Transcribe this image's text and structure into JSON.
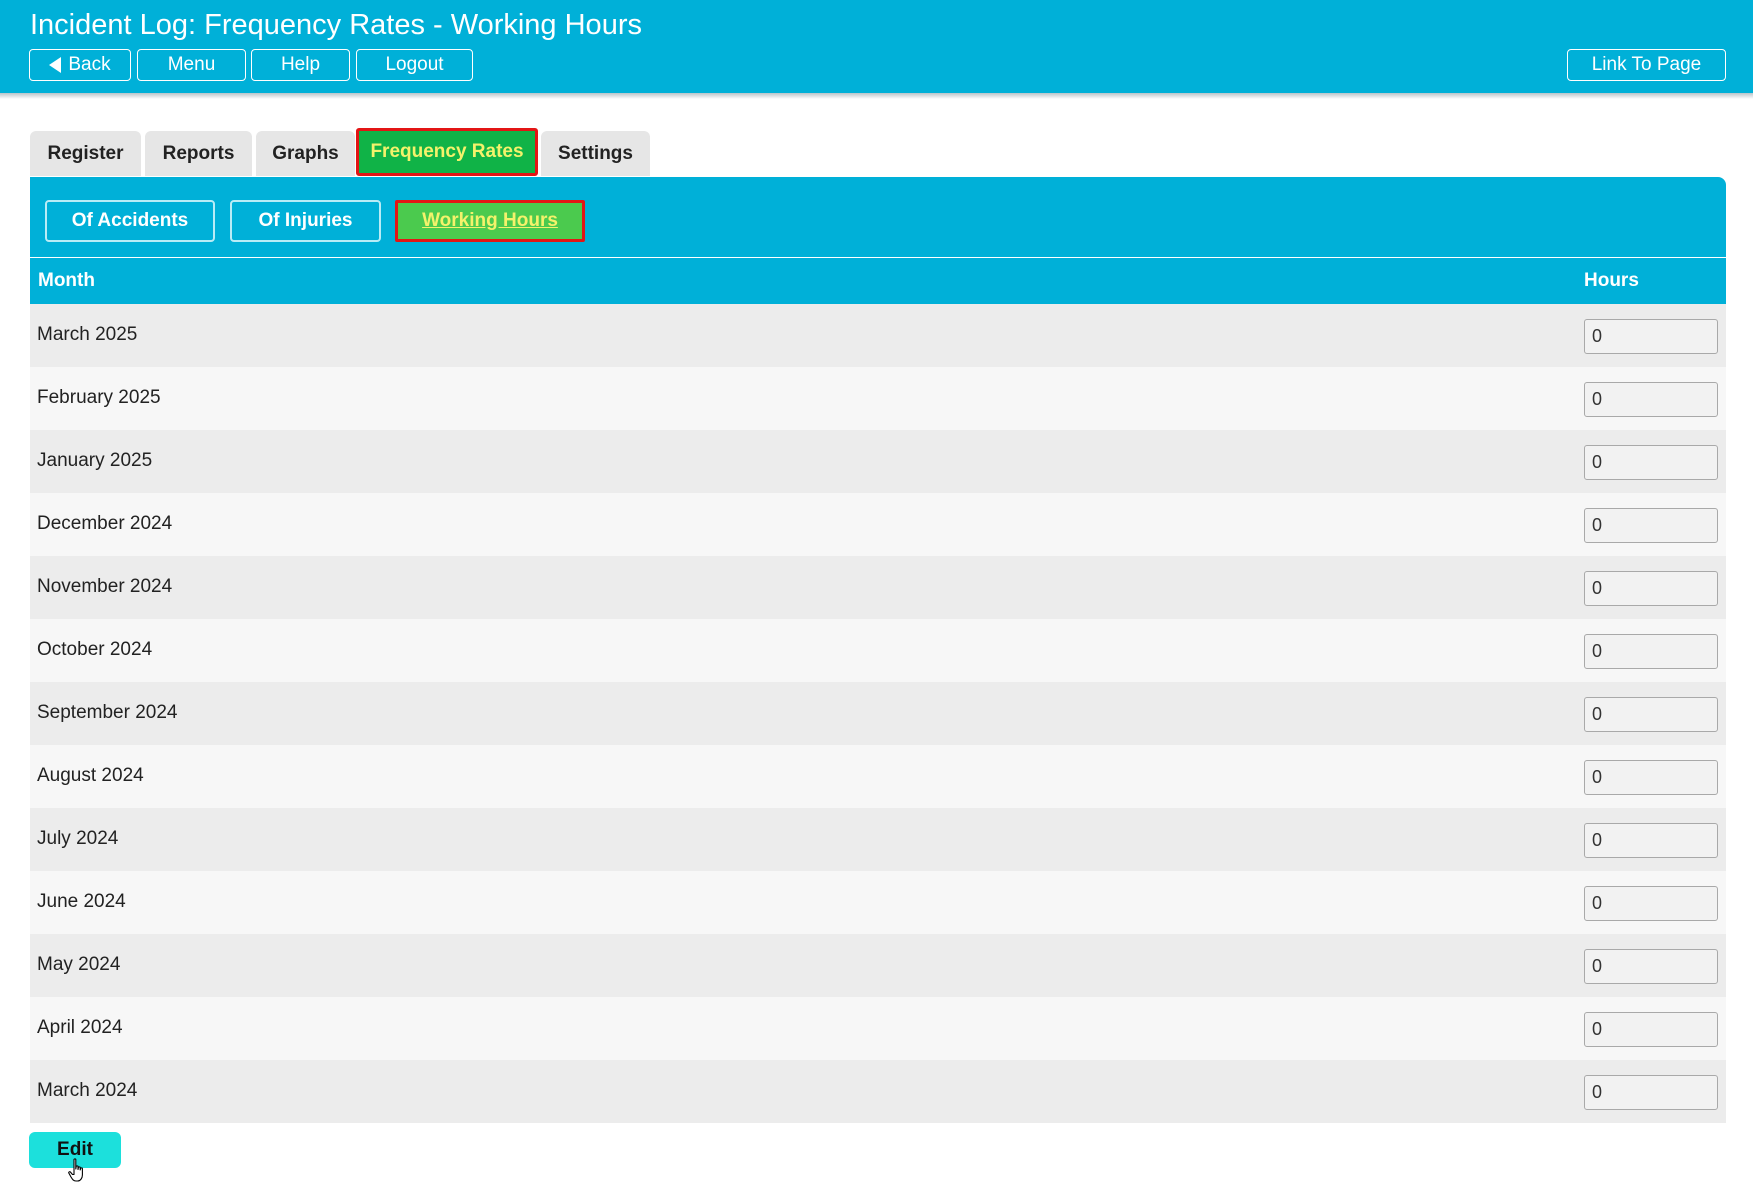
{
  "header": {
    "title": "Incident Log: Frequency Rates - Working Hours",
    "buttons": {
      "back": "Back",
      "menu": "Menu",
      "help": "Help",
      "logout": "Logout",
      "link_to_page": "Link To Page"
    }
  },
  "tabs": [
    {
      "label": "Register",
      "active": false
    },
    {
      "label": "Reports",
      "active": false
    },
    {
      "label": "Graphs",
      "active": false
    },
    {
      "label": "Frequency Rates",
      "active": true
    },
    {
      "label": "Settings",
      "active": false
    }
  ],
  "subtabs": [
    {
      "label": "Of Accidents",
      "active": false
    },
    {
      "label": "Of Injuries",
      "active": false
    },
    {
      "label": "Working Hours",
      "active": true
    }
  ],
  "table": {
    "columns": {
      "month": "Month",
      "hours": "Hours"
    },
    "rows": [
      {
        "month": "March 2025",
        "hours": "0"
      },
      {
        "month": "February 2025",
        "hours": "0"
      },
      {
        "month": "January 2025",
        "hours": "0"
      },
      {
        "month": "December 2024",
        "hours": "0"
      },
      {
        "month": "November 2024",
        "hours": "0"
      },
      {
        "month": "October 2024",
        "hours": "0"
      },
      {
        "month": "September 2024",
        "hours": "0"
      },
      {
        "month": "August 2024",
        "hours": "0"
      },
      {
        "month": "July 2024",
        "hours": "0"
      },
      {
        "month": "June 2024",
        "hours": "0"
      },
      {
        "month": "May 2024",
        "hours": "0"
      },
      {
        "month": "April 2024",
        "hours": "0"
      },
      {
        "month": "March 2024",
        "hours": "0"
      }
    ]
  },
  "actions": {
    "edit_label": "Edit"
  },
  "icons": {
    "back": "back-arrow-icon",
    "cursor": "hand-pointer-icon"
  },
  "colors": {
    "brand": "#00b0d8",
    "active_tab": "#10b347",
    "active_subtab": "#4bca4e",
    "highlight_border": "#e31515",
    "active_text": "#f4f26b",
    "edit_button": "#1ce0dc"
  }
}
